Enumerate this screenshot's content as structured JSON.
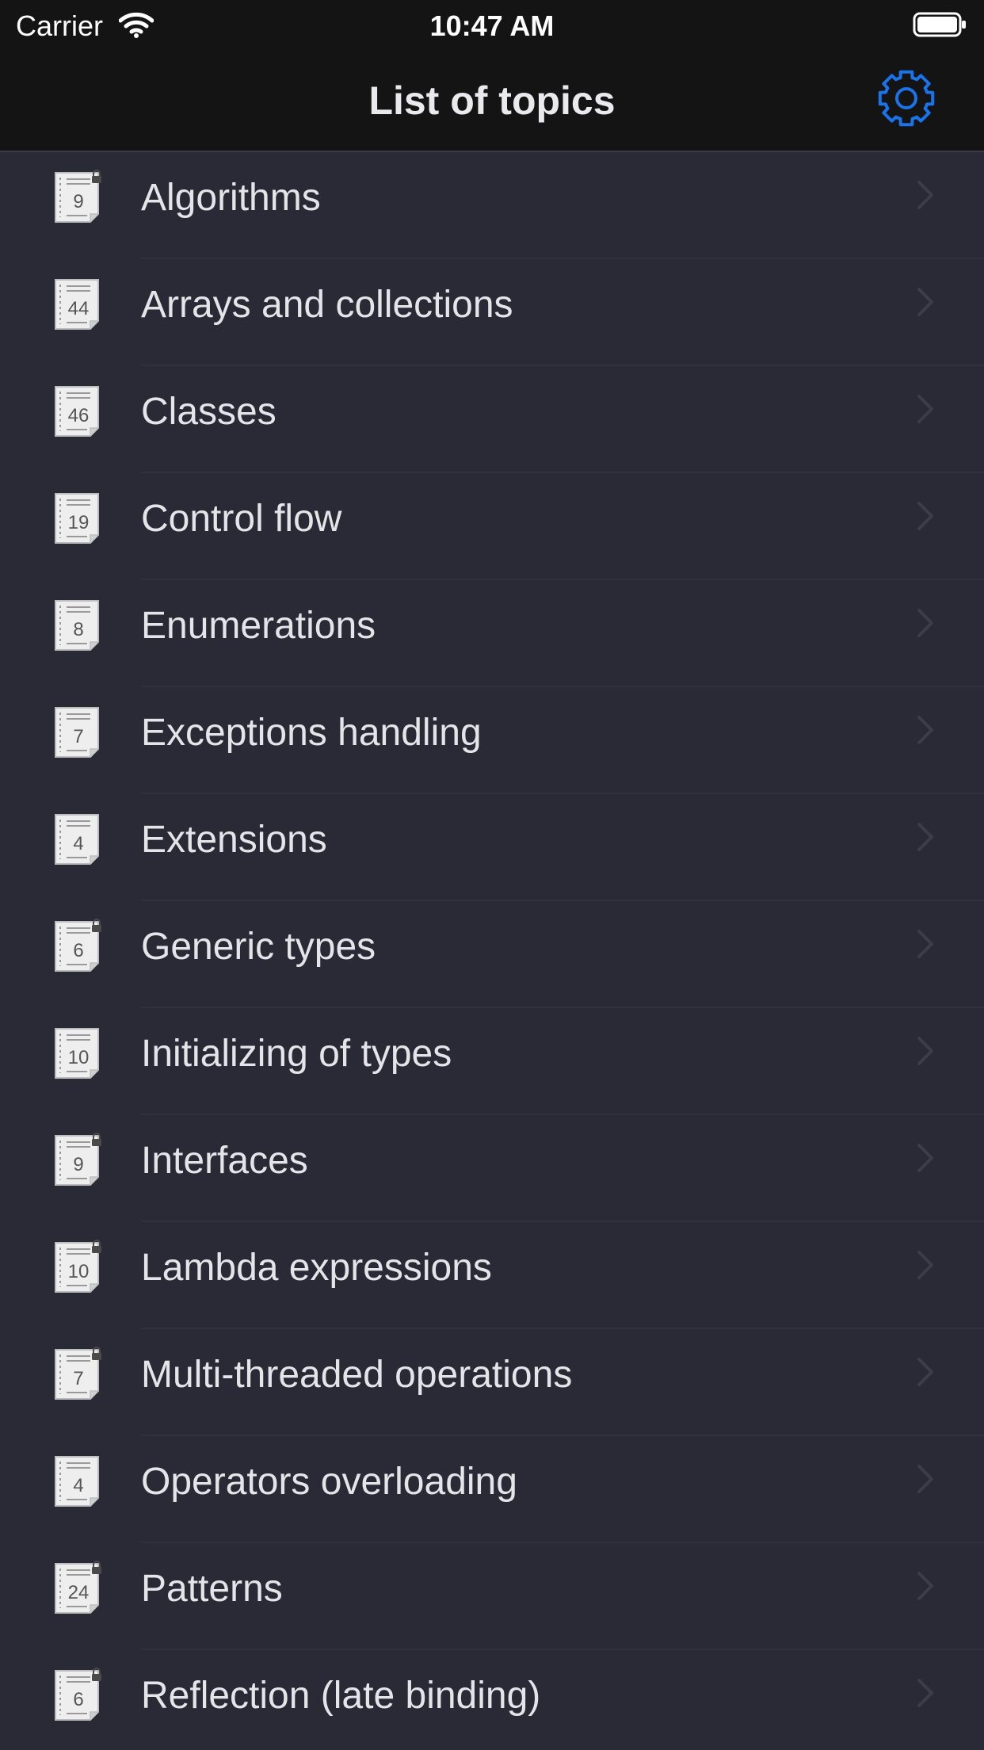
{
  "status_bar": {
    "carrier": "Carrier",
    "time": "10:47 AM"
  },
  "nav": {
    "title": "List of topics",
    "settings_icon": "gear-icon"
  },
  "colors": {
    "accent": "#1a73e8",
    "background": "#292a36",
    "nav_background": "#141414"
  },
  "topics": [
    {
      "label": "Algorithms",
      "count": "9",
      "locked": true
    },
    {
      "label": "Arrays and collections",
      "count": "44",
      "locked": false
    },
    {
      "label": "Classes",
      "count": "46",
      "locked": false
    },
    {
      "label": "Control flow",
      "count": "19",
      "locked": false
    },
    {
      "label": "Enumerations",
      "count": "8",
      "locked": false
    },
    {
      "label": "Exceptions handling",
      "count": "7",
      "locked": false
    },
    {
      "label": "Extensions",
      "count": "4",
      "locked": false
    },
    {
      "label": "Generic types",
      "count": "6",
      "locked": true
    },
    {
      "label": "Initializing of types",
      "count": "10",
      "locked": false
    },
    {
      "label": "Interfaces",
      "count": "9",
      "locked": true
    },
    {
      "label": "Lambda expressions",
      "count": "10",
      "locked": true
    },
    {
      "label": "Multi-threaded operations",
      "count": "7",
      "locked": true
    },
    {
      "label": "Operators overloading",
      "count": "4",
      "locked": false
    },
    {
      "label": "Patterns",
      "count": "24",
      "locked": true
    },
    {
      "label": "Reflection (late binding)",
      "count": "6",
      "locked": true
    }
  ]
}
